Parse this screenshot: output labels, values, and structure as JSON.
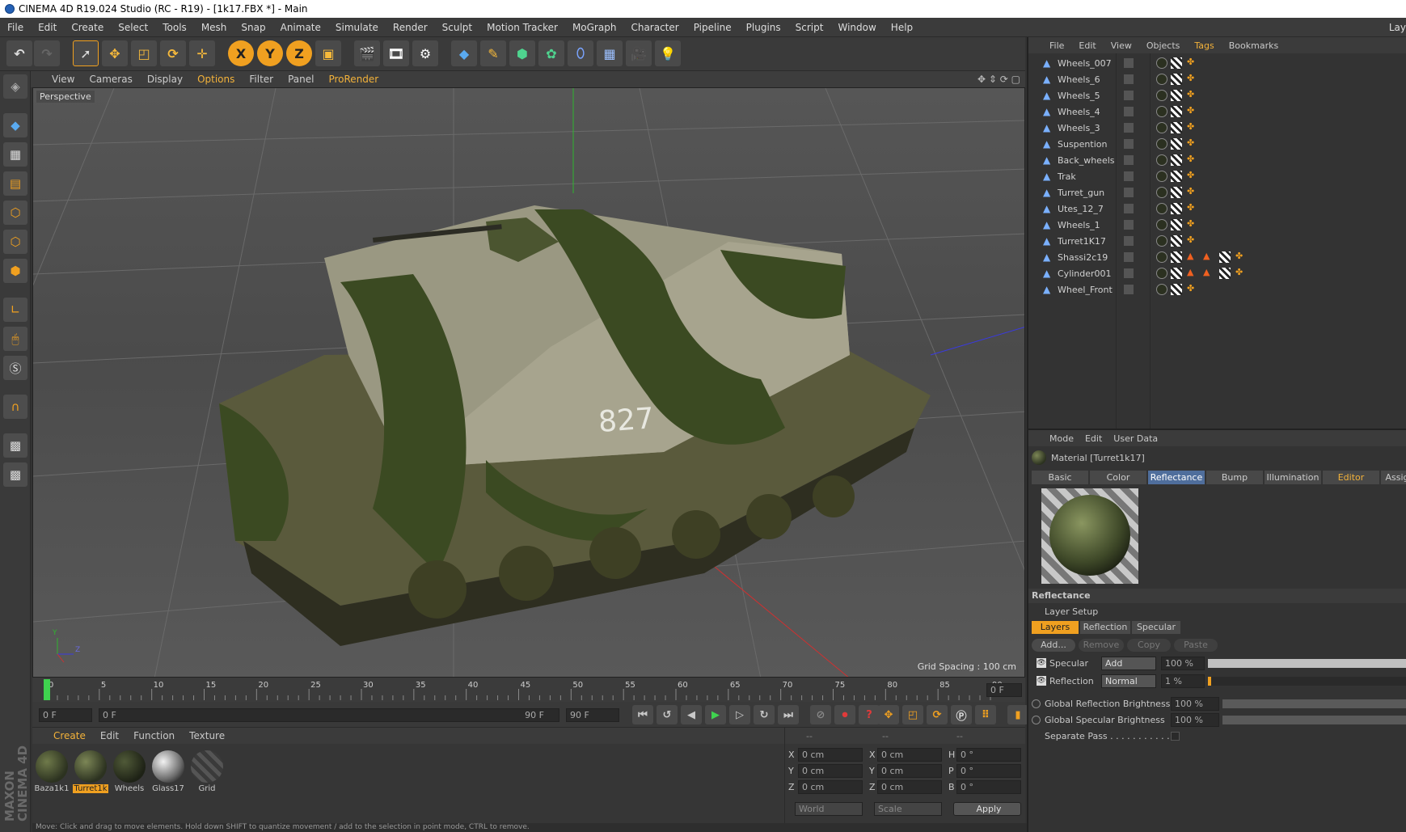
{
  "window": {
    "title": "CINEMA 4D R19.024 Studio (RC - R19) - [1k17.FBX *] - Main",
    "layout_cut": "Lay"
  },
  "menu": [
    "File",
    "Edit",
    "Create",
    "Select",
    "Tools",
    "Mesh",
    "Snap",
    "Animate",
    "Simulate",
    "Render",
    "Sculpt",
    "Motion Tracker",
    "MoGraph",
    "Character",
    "Pipeline",
    "Plugins",
    "Script",
    "Window",
    "Help"
  ],
  "viewport": {
    "menu": [
      "View",
      "Cameras",
      "Display",
      "Options",
      "Filter",
      "Panel",
      "ProRender"
    ],
    "label": "Perspective",
    "grid_spacing": "Grid Spacing : 100 cm",
    "tank_number": "827",
    "axis_y": "Y",
    "axis_z": "Z"
  },
  "timeline": {
    "ticks": [
      "0",
      "5",
      "10",
      "15",
      "20",
      "25",
      "30",
      "35",
      "40",
      "45",
      "50",
      "55",
      "60",
      "65",
      "70",
      "75",
      "80",
      "85",
      "90"
    ],
    "current": "0 F",
    "start": "0 F",
    "range_start": "0 F",
    "range_end": "90 F",
    "end": "90 F"
  },
  "materials": {
    "menu": [
      "Create",
      "Edit",
      "Function",
      "Texture"
    ],
    "items": [
      {
        "name": "Baza1k1"
      },
      {
        "name": "Turret1k"
      },
      {
        "name": "Wheels"
      },
      {
        "name": "Glass17"
      },
      {
        "name": "Grid"
      }
    ]
  },
  "coords": {
    "header": [
      "--",
      "--",
      "--"
    ],
    "rows": [
      [
        "X",
        "0 cm",
        "X",
        "0 cm",
        "H",
        "0 °"
      ],
      [
        "Y",
        "0 cm",
        "Y",
        "0 cm",
        "P",
        "0 °"
      ],
      [
        "Z",
        "0 cm",
        "Z",
        "0 cm",
        "B",
        "0 °"
      ]
    ],
    "world": "World",
    "scale": "Scale",
    "apply": "Apply"
  },
  "objects": {
    "menu": [
      "File",
      "Edit",
      "View",
      "Objects",
      "Tags",
      "Bookmarks"
    ],
    "items": [
      "Wheels_007",
      "Wheels_6",
      "Wheels_5",
      "Wheels_4",
      "Wheels_3",
      "Suspention",
      "Back_wheels",
      "Trak",
      "Turret_gun",
      "Utes_12_7",
      "Wheels_1",
      "Turret1K17",
      "Shassi2c19",
      "Cylinder001",
      "Wheel_Front"
    ]
  },
  "attributes": {
    "menu": [
      "Mode",
      "Edit",
      "User Data"
    ],
    "material": "Material [Turret1k17]",
    "tabs": [
      "Basic",
      "Color",
      "Reflectance",
      "Bump",
      "Illumination",
      "Editor",
      "Assig"
    ],
    "section": "Reflectance",
    "layer_setup": "Layer Setup",
    "layer_tabs": [
      "Layers",
      "Reflection",
      "Specular"
    ],
    "buttons": [
      "Add...",
      "Remove",
      "Copy",
      "Paste"
    ],
    "specular": {
      "label": "Specular",
      "mode": "Add",
      "value": "100 %"
    },
    "reflection": {
      "label": "Reflection",
      "mode": "Normal",
      "value": "1 %"
    },
    "global_reflection": {
      "label": "Global Reflection Brightness",
      "value": "100 %"
    },
    "global_specular": {
      "label": "Global Specular Brightness",
      "value": "100 %"
    },
    "separate_pass": "Separate Pass . . . . . . . . . . ."
  },
  "status": "Move: Click and drag to move elements. Hold down SHIFT to quantize movement / add to the selection in point mode, CTRL to remove.",
  "logo": "MAXON CINEMA 4D"
}
